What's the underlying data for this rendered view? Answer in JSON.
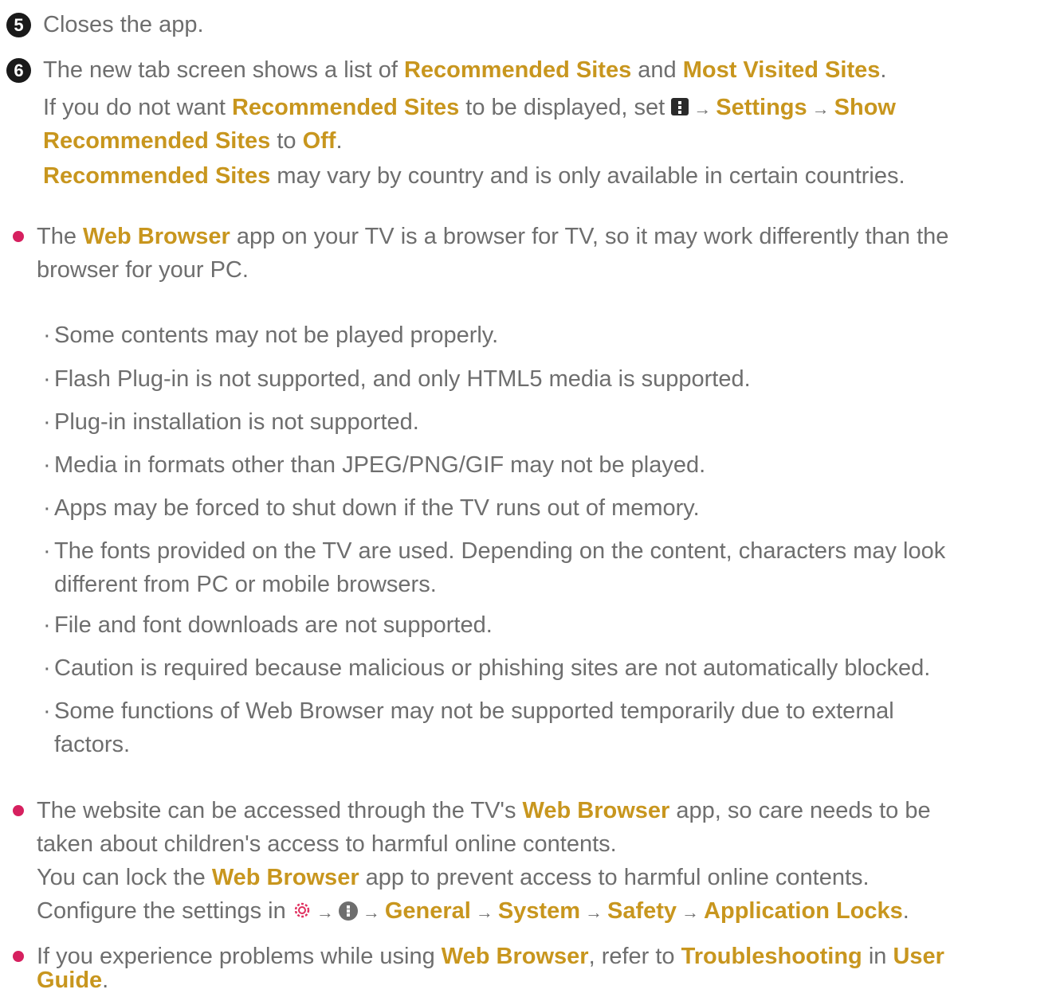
{
  "step5": {
    "num": "5",
    "text": "Closes the app."
  },
  "step6": {
    "num": "6",
    "l1": {
      "a": "The new tab screen shows a list of ",
      "b": "Recommended Sites",
      "c": " and ",
      "d": "Most Visited Sites",
      "e": "."
    },
    "l2": {
      "a": "If you do not want ",
      "b": "Recommended Sites",
      "c": " to be displayed, set ",
      "d": "Settings",
      "e": "Show"
    },
    "l3": {
      "a": "Recommended Sites",
      "b": " to ",
      "c": "Off",
      "d": "."
    },
    "l4": {
      "a": "Recommended Sites",
      "b": " may vary by country and is only available in certain countries."
    }
  },
  "bullet1": {
    "l1": {
      "a": "The ",
      "b": "Web Browser",
      "c": " app on your TV is a browser for TV, so it may work differently than the"
    },
    "l2": "browser for your PC.",
    "items": [
      "Some contents may not be played properly.",
      "Flash Plug-in is not supported, and only HTML5 media is supported.",
      "Plug-in installation is not supported.",
      "Media in formats other than JPEG/PNG/GIF may not be played.",
      "Apps may be forced to shut down if the TV runs out of memory.",
      "The fonts provided on the TV are used. Depending on the content, characters may look",
      "different from PC or mobile browsers.",
      "File and font downloads are not supported.",
      "Caution is required because malicious or phishing sites are not automatically blocked.",
      "Some functions of Web Browser may not be supported temporarily due to external",
      "factors."
    ]
  },
  "bullet2": {
    "l1": {
      "a": "The website can be accessed through the TV's ",
      "b": "Web Browser",
      "c": " app, so care needs to be"
    },
    "l2": "taken about children's access to harmful online contents.",
    "l3": {
      "a": "You can lock the ",
      "b": "Web Browser",
      "c": " app to prevent access to harmful online contents."
    },
    "l4": {
      "a": "Configure the settings in ",
      "b": "General",
      "c": "System",
      "d": "Safety",
      "e": "Application Locks",
      "f": "."
    }
  },
  "bullet3": {
    "l1": {
      "a": "If you experience problems while using ",
      "b": "Web Browser",
      "c": ", refer to ",
      "d": "Troubleshooting",
      "e": " in ",
      "f": "User"
    },
    "l2": {
      "a": "Guide",
      "b": "."
    }
  },
  "arrow": "→",
  "sub_mark": "·",
  "colors": {
    "accent": "#c8961e",
    "text": "#6e6e6e",
    "bullet": "#d6205f"
  },
  "icons": [
    "menu-icon",
    "gear-icon",
    "settings-circle-icon"
  ]
}
